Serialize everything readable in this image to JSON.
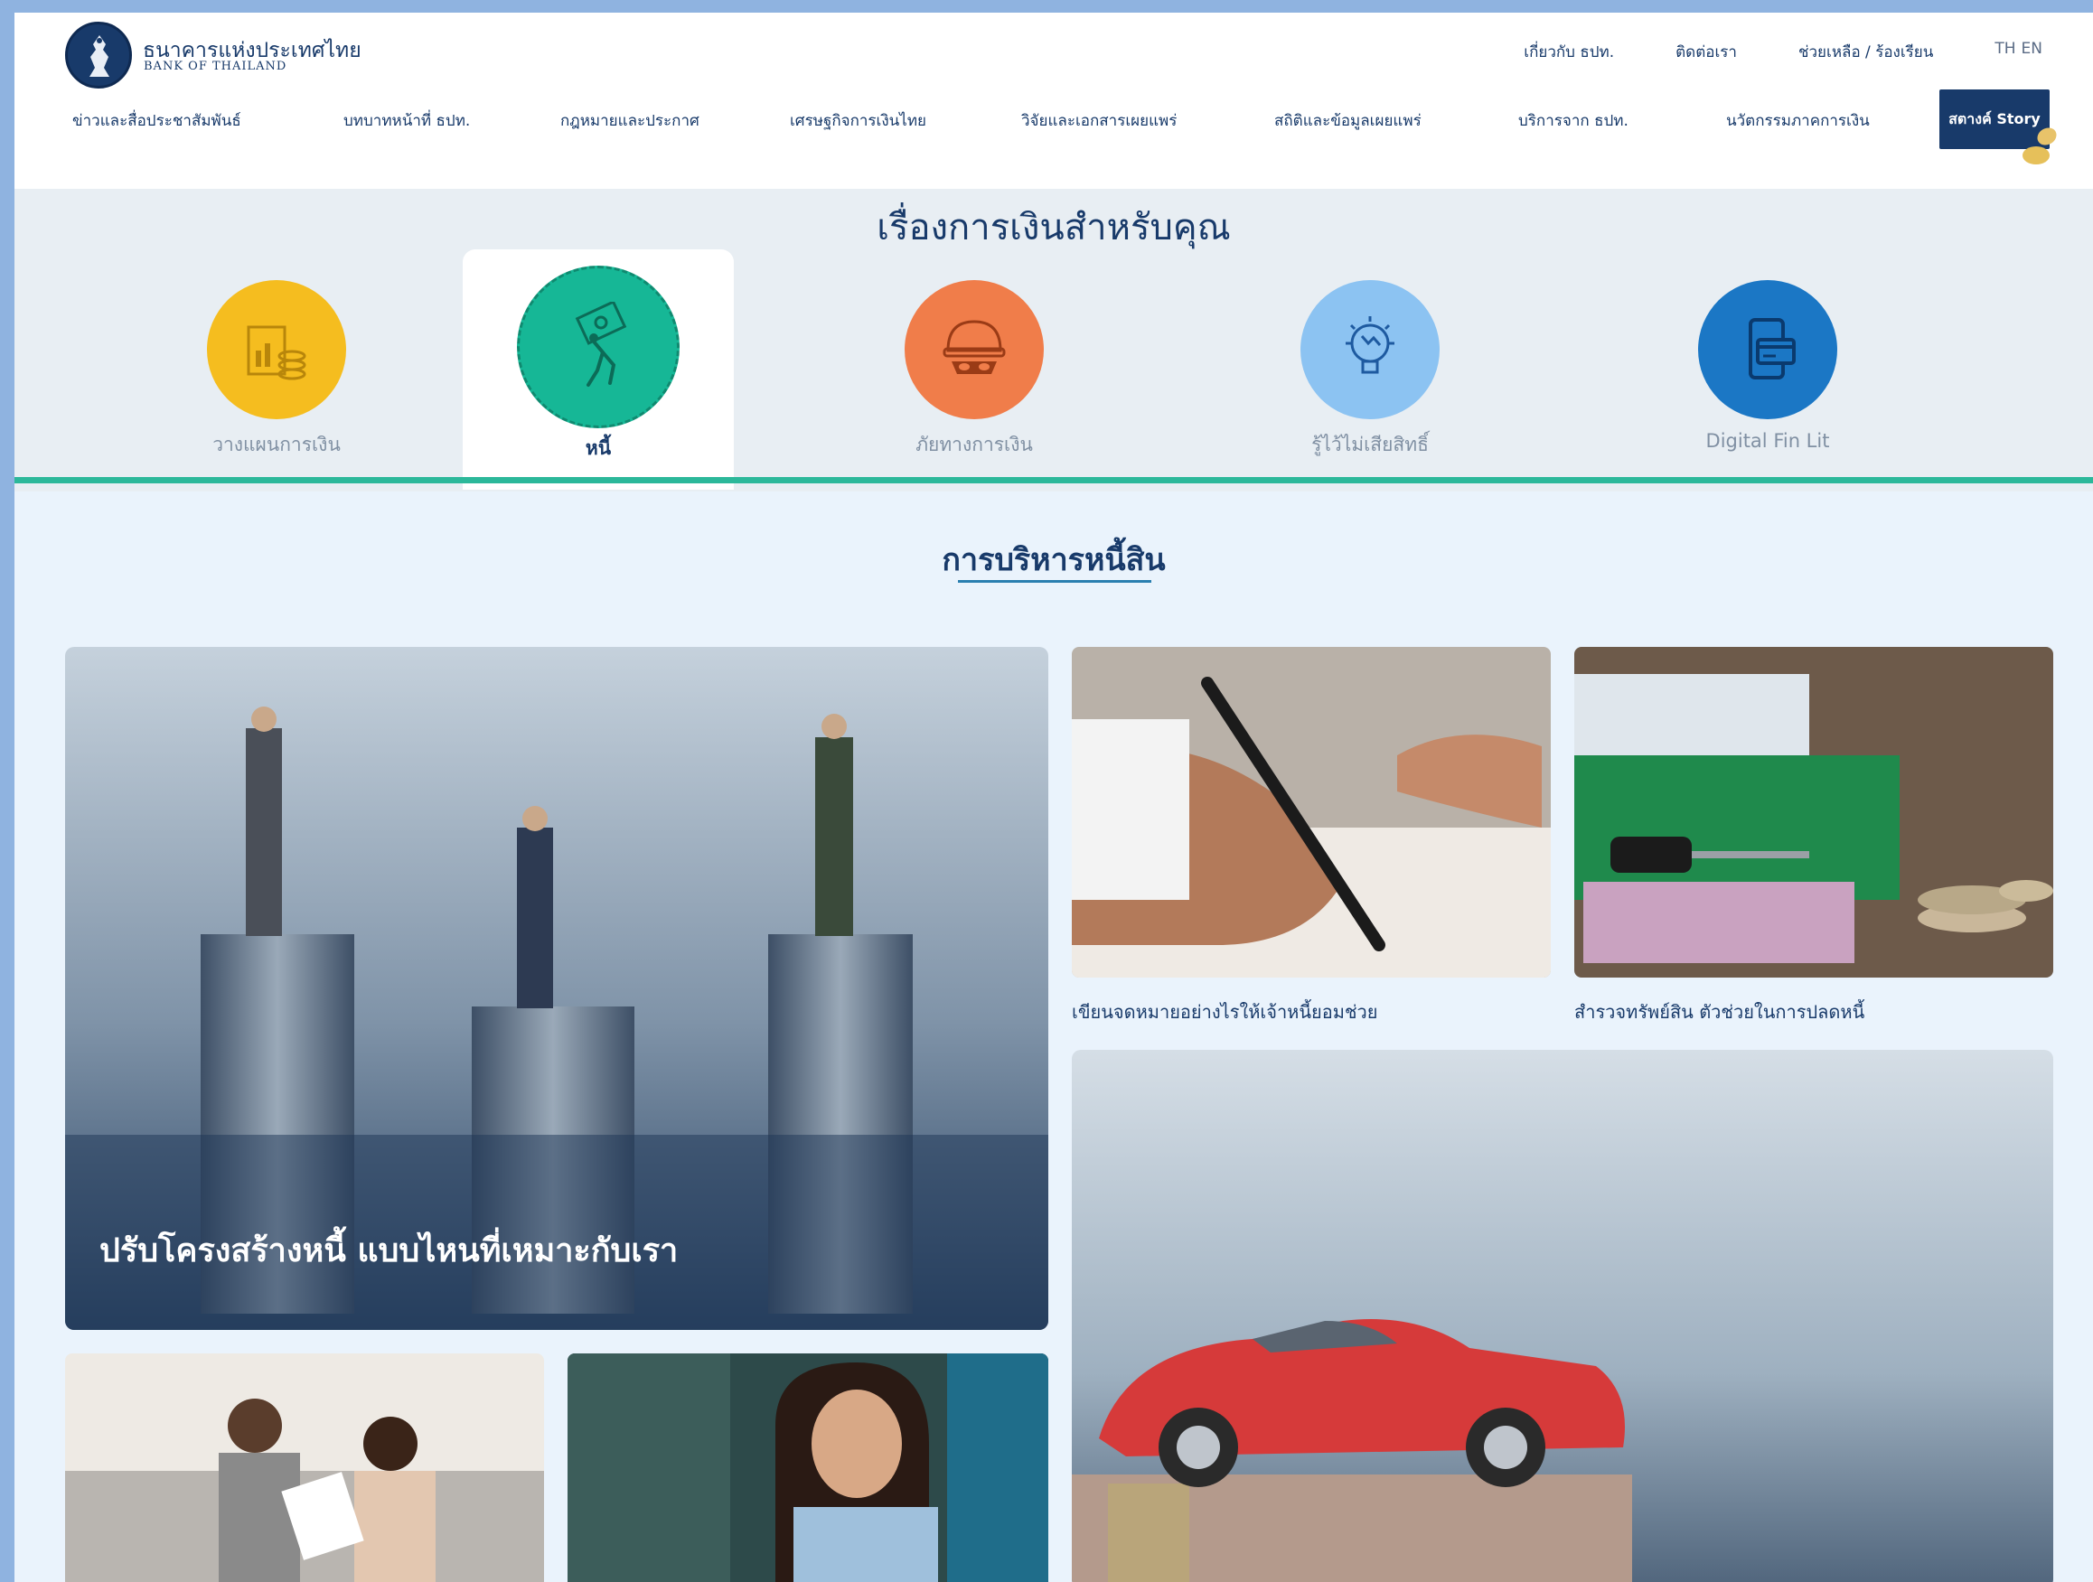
{
  "header": {
    "logo_th": "ธนาคารแห่งประเทศไทย",
    "logo_en": "BANK OF THAILAND",
    "top_links": [
      "เกี่ยวกับ ธปท.",
      "ติดต่อเรา",
      "ช่วยเหลือ / ร้องเรียน"
    ],
    "lang_th": "TH",
    "lang_en": "EN",
    "nav": [
      "ข่าวและสื่อประชาสัมพันธ์",
      "บทบาทหน้าที่ ธปท.",
      "กฎหมายและประกาศ",
      "เศรษฐกิจการเงินไทย",
      "วิจัยและเอกสารเผยแพร่",
      "สถิติและข้อมูลเผยแพร่",
      "บริการจาก ธปท.",
      "นวัตกรรมภาคการเงิน"
    ],
    "story_label": "สตางค์ Story"
  },
  "band": {
    "title": "เรื่องการเงินสำหรับคุณ",
    "categories": [
      {
        "label": "วางแผนการเงิน",
        "color": "#f5bd1f"
      },
      {
        "label": "หนี้",
        "color": "#16b796"
      },
      {
        "label": "ภัยทางการเงิน",
        "color": "#f07d4a"
      },
      {
        "label": "รู้ไว้ไม่เสียสิทธิ์",
        "color": "#8cc3f2"
      },
      {
        "label": "Digital Fin Lit",
        "color": "#1b77c5"
      }
    ]
  },
  "section": {
    "title": "การบริหารหนี้สิน"
  },
  "articles": {
    "main": "ปรับโครงสร้างหนี้ แบบไหนที่เหมาะกับเรา",
    "letter": "เขียนจดหมายอย่างไรให้เจ้าหนี้ยอมช่วย",
    "assets": "สำรวจทรัพย์สิน ตัวช่วยในการปลดหนี้"
  }
}
